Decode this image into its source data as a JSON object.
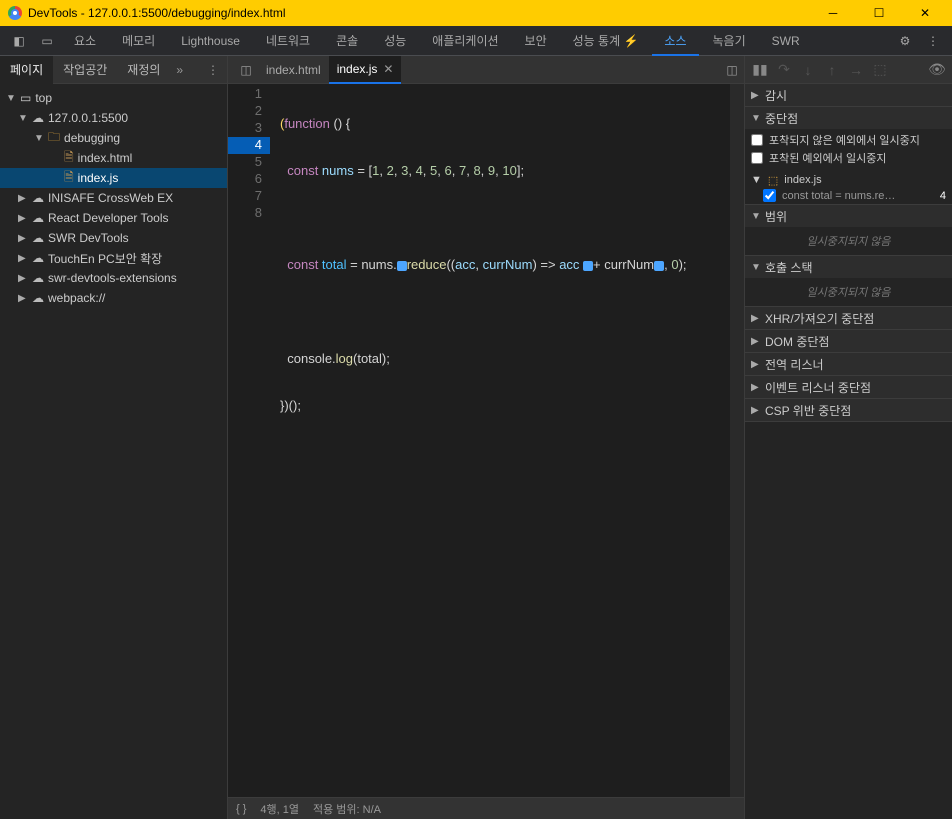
{
  "window": {
    "title": "DevTools - 127.0.0.1:5500/debugging/index.html"
  },
  "menu": {
    "items": [
      "요소",
      "메모리",
      "Lighthouse",
      "네트워크",
      "콘솔",
      "성능",
      "애플리케이션",
      "보안",
      "성능 통계 ⚡",
      "소스",
      "녹음기",
      "SWR"
    ],
    "active": 9
  },
  "left": {
    "tabs": [
      "페이지",
      "작업공간",
      "재정의"
    ],
    "active": 0,
    "tree": {
      "top": "top",
      "host": "127.0.0.1:5500",
      "folder": "debugging",
      "files": [
        "index.html",
        "index.js"
      ],
      "selected": "index.js",
      "ext": [
        "INISAFE CrossWeb EX",
        "React Developer Tools",
        "SWR DevTools",
        "TouchEn PC보안 확장",
        "swr-devtools-extensions",
        "webpack://"
      ]
    }
  },
  "center": {
    "tabs": [
      {
        "name": "index.html",
        "active": false
      },
      {
        "name": "index.js",
        "active": true
      }
    ],
    "code": {
      "lines": [
        1,
        2,
        3,
        4,
        5,
        6,
        7,
        8
      ],
      "bpline": 4,
      "l1a": "(",
      "l1b": "function",
      "l1c": " () {",
      "l2a": "const",
      "l2b": " nums ",
      "l2c": "= [",
      "l2d": "1",
      "l2e": ", ",
      "l2f": "2",
      "l2g": "3",
      "l2h": "4",
      "l2i": "5",
      "l2j": "6",
      "l2k": "7",
      "l2l": "8",
      "l2m": "9",
      "l2n": "10",
      "l2o": "];",
      "l4a": "const",
      "l4b": " total ",
      "l4c": "= nums.",
      "l4d": "reduce",
      "l4e": "((",
      "l4f": "acc",
      "l4g": ", ",
      "l4h": "currNum",
      "l4i": ") => ",
      "l4j": "acc ",
      "l4k": "+ currNum",
      "l4l": ", ",
      "l4m": "0",
      "l4n": ");",
      "l6a": "console.",
      "l6b": "log",
      "l6c": "(total);",
      "l7": "})();"
    },
    "status": {
      "pos": "4행, 1열",
      "cov": "적용 범위: N/A"
    }
  },
  "right": {
    "watch": "감시",
    "breakpoints": "중단점",
    "uncaught": "포착되지 않은 예외에서 일시중지",
    "caught": "포착된 예외에서 일시중지",
    "bpfile": "index.js",
    "bptext": "const total = nums.re",
    "bpdots": "…",
    "bplineno": "4",
    "scope": "범위",
    "scopeempty": "일시중지되지 않음",
    "callstack": "호출 스택",
    "stackempty": "일시중지되지 않음",
    "xhr": "XHR/가져오기 중단점",
    "dom": "DOM 중단점",
    "global": "전역 리스너",
    "event": "이벤트 리스너 중단점",
    "csp": "CSP 위반 중단점"
  }
}
